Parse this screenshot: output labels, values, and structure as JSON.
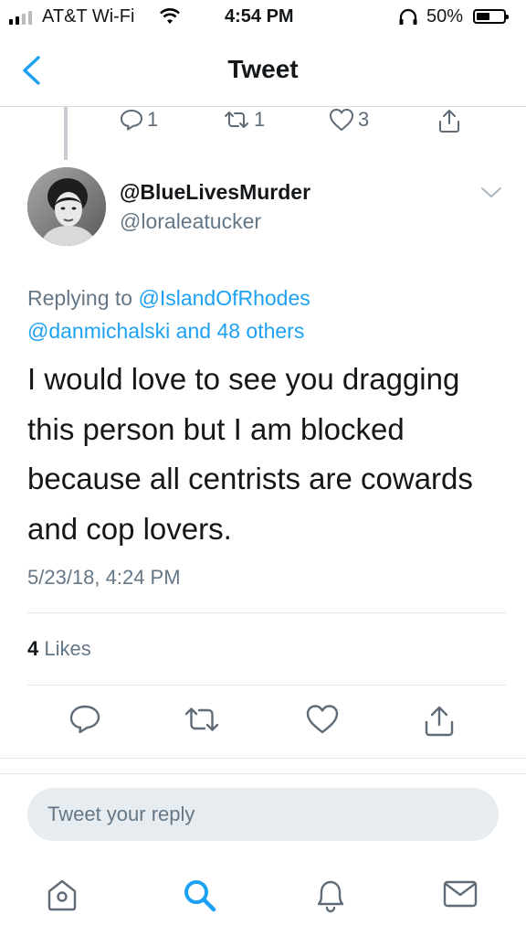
{
  "status_bar": {
    "carrier": "AT&T Wi-Fi",
    "time": "4:54 PM",
    "battery": "50%",
    "battery_level": 0.5
  },
  "nav": {
    "title": "Tweet",
    "back_icon": "chevron-left-icon"
  },
  "previous_tweet_actions": {
    "replies": "1",
    "retweets": "1",
    "likes": "3"
  },
  "tweet": {
    "display_name": "@BlueLivesMurder",
    "handle": "@loraleatucker",
    "replying_prefix": "Replying to ",
    "replying_to_primary": "@IslandOfRhodes",
    "replying_to_secondary": "@danmichalski and 48 others",
    "text": "I would love to see you dragging this person but I am blocked because all centrists are cowards and cop lovers.",
    "timestamp": "5/23/18, 4:24 PM",
    "likes_count": "4",
    "likes_label": " Likes"
  },
  "reply_box": {
    "placeholder": "Tweet your reply"
  },
  "tab_bar": {
    "items": [
      "home-icon",
      "search-icon",
      "notifications-icon",
      "messages-icon"
    ]
  },
  "colors": {
    "accent": "#1da1f2",
    "secondary_text": "#657786",
    "divider": "#e1e8ed"
  }
}
